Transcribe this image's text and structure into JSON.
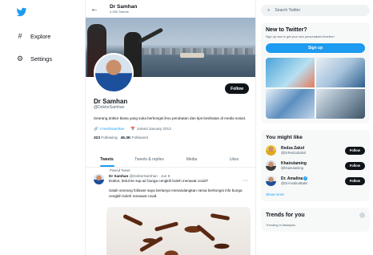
{
  "nav": {
    "logo": "twitter-bird-icon",
    "items": [
      {
        "label": "Explore",
        "icon": "hashtag-icon"
      },
      {
        "label": "Settings",
        "icon": "gear-icon"
      }
    ]
  },
  "header": {
    "name": "Dr Samhan",
    "tweets": "4,265 Tweets"
  },
  "profile": {
    "name": "Dr Samhan",
    "handle": "@DoktorSamhan",
    "bio": "Seorang doktor biasa yang suka berkongsi ilmu perubatan dan tips kesihatan di media sosial.",
    "link": "t.me/drsamhan",
    "joined": "Joined January 2013",
    "following_count": "323",
    "following_label": "Following",
    "followers_count": "45.3K",
    "followers_label": "Followers",
    "follow_button": "Follow"
  },
  "tabs": [
    {
      "label": "Tweets",
      "active": true
    },
    {
      "label": "Tweets & replies",
      "active": false
    },
    {
      "label": "Media",
      "active": false
    },
    {
      "label": "Likes",
      "active": false
    }
  ],
  "tweet": {
    "pinned": "Pinned Tweet",
    "author": "Dr Samhan",
    "meta": "@DoktorSamhan · Jun 9",
    "text": "Doktor, betul ke sup air bunga cengkih boleh merawat covid?",
    "text2": "Salah seorang follower saya bertanya menandangkan ramai berkongsi info bunga cengkih boleh merawat covid."
  },
  "search": {
    "placeholder": "Search Twitter"
  },
  "signup_card": {
    "title": "New to Twitter?",
    "subtitle": "Sign up now to get your own personalized timeline!",
    "button": "Sign up"
  },
  "suggestions": {
    "title": "You might like",
    "users": [
      {
        "name": "Redza Zakol",
        "handle": "@DrRedzaZahol",
        "button": "Follow",
        "verified": false
      },
      {
        "name": "Khairulaming",
        "handle": "@khairulaming",
        "button": "Follow",
        "verified": false
      },
      {
        "name": "Dr. Amalina",
        "handle": "@DrAmalinaBakri",
        "button": "Follow",
        "verified": true
      }
    ],
    "show_more": "Show more"
  },
  "trends": {
    "title": "Trends for you",
    "subtitle": "Trending in Malaysia"
  },
  "colors": {
    "accent": "#1d9bf0",
    "dark": "#0f1419"
  }
}
